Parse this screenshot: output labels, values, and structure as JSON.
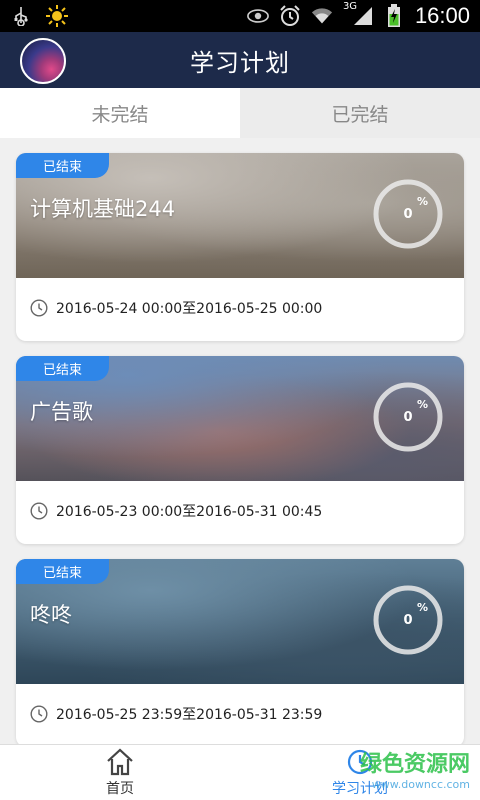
{
  "status_bar": {
    "time": "16:00",
    "network": "3G",
    "icons": [
      "usb-icon",
      "sun-icon",
      "eye-icon",
      "alarm-icon",
      "wifi-icon",
      "signal-icon",
      "battery-charging-icon"
    ]
  },
  "header": {
    "title": "学习计划"
  },
  "tabs": [
    {
      "label": "未完结",
      "active": true
    },
    {
      "label": "已完结",
      "active": false
    }
  ],
  "plans": [
    {
      "badge": "已结束",
      "title": "计算机基础244",
      "progress": "0",
      "progress_unit": "%",
      "period": "2016-05-24 00:00至2016-05-25 00:00"
    },
    {
      "badge": "已结束",
      "title": "广告歌",
      "progress": "0",
      "progress_unit": "%",
      "period": "2016-05-23 00:00至2016-05-31 00:45"
    },
    {
      "badge": "已结束",
      "title": "咚咚",
      "progress": "0",
      "progress_unit": "%",
      "period": "2016-05-25 23:59至2016-05-31 23:59"
    }
  ],
  "bottom_nav": [
    {
      "label": "首页",
      "icon": "home-icon",
      "active": false
    },
    {
      "label": "学习计划",
      "icon": "study-plan-icon",
      "active": true
    }
  ],
  "watermark": {
    "line1": "绿色资源网",
    "line2": "www.downcc.com"
  },
  "colors": {
    "header_bg": "#1d2a4a",
    "accent": "#2f86e8",
    "badge_bg": "#2f86e8"
  }
}
